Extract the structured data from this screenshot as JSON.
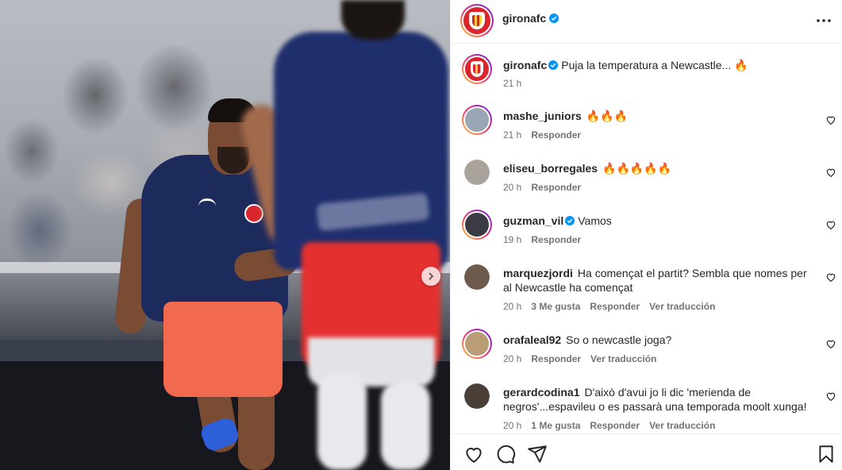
{
  "post": {
    "account": "gironafc",
    "caption": {
      "user": "gironafc",
      "text": "Puja la temperatura a Newcastle... 🔥",
      "time": "21 h"
    }
  },
  "comments": [
    {
      "user": "mashe_juniors",
      "verified": false,
      "text": "🔥🔥🔥",
      "time": "21 h",
      "likes": "",
      "reply": "Responder",
      "translate": "",
      "avatar_color": "#9aa6b4"
    },
    {
      "user": "eliseu_borregales",
      "verified": false,
      "text": "🔥🔥🔥🔥🔥",
      "time": "20 h",
      "likes": "",
      "reply": "Responder",
      "translate": "",
      "avatar_color": "#a9a39c"
    },
    {
      "user": "guzman_vil",
      "verified": true,
      "text": "Vamos",
      "time": "19 h",
      "likes": "",
      "reply": "Responder",
      "translate": "",
      "avatar_color": "#3b3b44"
    },
    {
      "user": "marquezjordi",
      "verified": false,
      "text": "Ha començat el partit? Sembla que nomes per al Newcastle ha començat",
      "time": "20 h",
      "likes": "3 Me gusta",
      "reply": "Responder",
      "translate": "Ver traducción",
      "avatar_color": "#6c5a4c"
    },
    {
      "user": "orafaleal92",
      "verified": false,
      "text": "So o newcastle joga?",
      "time": "20 h",
      "likes": "",
      "reply": "Responder",
      "translate": "Ver traducción",
      "avatar_color": "#b89d76"
    },
    {
      "user": "gerardcodina1",
      "verified": false,
      "text": "D'això d'avui jo li dic 'merienda de negros'...espavileu o es passarà una temporada moolt xunga!",
      "time": "20 h",
      "likes": "1 Me gusta",
      "reply": "Responder",
      "translate": "Ver traducción",
      "avatar_color": "#4a4038"
    }
  ],
  "icons": {
    "verified": "verified-badge-icon",
    "more": "more-options-icon",
    "like": "heart-icon",
    "comment": "comment-icon",
    "share": "paper-plane-icon",
    "save": "bookmark-icon",
    "next": "chevron-right-icon"
  },
  "colors": {
    "verified": "#0095f6",
    "muted": "#737373",
    "text": "#262626",
    "girona_red": "#d9252b"
  }
}
